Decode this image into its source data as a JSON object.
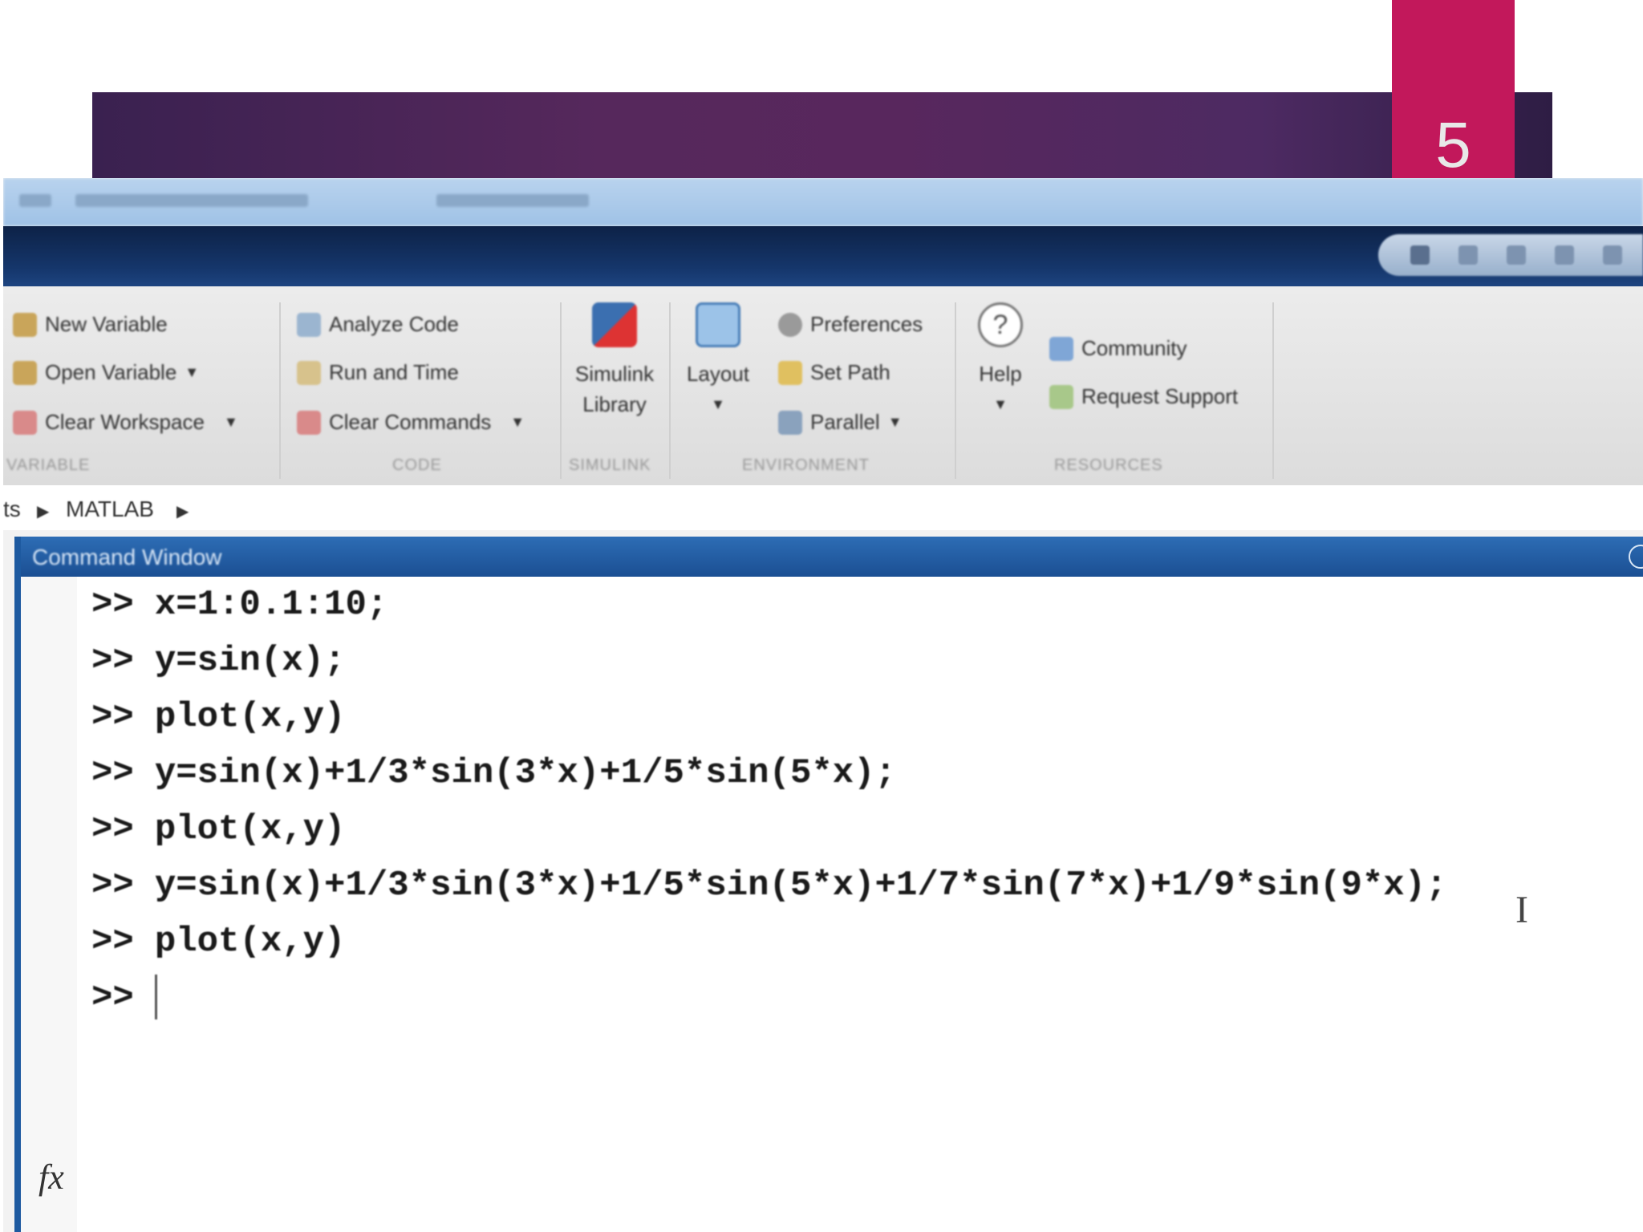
{
  "slide": {
    "number": "5"
  },
  "toolstrip": {
    "variable_group": {
      "items": [
        {
          "label": "New Variable",
          "icon": "new-variable-icon",
          "dropdown": false
        },
        {
          "label": "Open Variable",
          "icon": "open-variable-icon",
          "dropdown": true
        },
        {
          "label": "Clear Workspace",
          "icon": "clear-workspace-icon",
          "dropdown": true
        }
      ],
      "label": "VARIABLE"
    },
    "code_group": {
      "items": [
        {
          "label": "Analyze Code",
          "icon": "analyze-code-icon",
          "dropdown": false
        },
        {
          "label": "Run and Time",
          "icon": "run-and-time-icon",
          "dropdown": false
        },
        {
          "label": "Clear Commands",
          "icon": "clear-commands-icon",
          "dropdown": true
        }
      ],
      "label": "CODE"
    },
    "simulink_group": {
      "button_line1": "Simulink",
      "button_line2": "Library",
      "label": "SIMULINK"
    },
    "environment_group": {
      "layout_label": "Layout",
      "items": [
        {
          "label": "Preferences",
          "icon": "preferences-icon",
          "dropdown": false
        },
        {
          "label": "Set Path",
          "icon": "set-path-icon",
          "dropdown": false
        },
        {
          "label": "Parallel",
          "icon": "parallel-icon",
          "dropdown": true
        }
      ],
      "label": "ENVIRONMENT"
    },
    "resources_group": {
      "help_label": "Help",
      "items": [
        {
          "label": "Community",
          "icon": "community-icon"
        },
        {
          "label": "Request Support",
          "icon": "request-support-icon"
        }
      ],
      "label": "RESOURCES"
    }
  },
  "pathbar": {
    "crumb_prefix": "ts",
    "crumb_current": "MATLAB"
  },
  "command_window": {
    "title": "Command Window",
    "prompt": ">>",
    "lines": [
      "x=1:0.1:10;",
      "y=sin(x);",
      "plot(x,y)",
      "y=sin(x)+1/3*sin(3*x)+1/5*sin(5*x);",
      "plot(x,y)",
      "y=sin(x)+1/3*sin(3*x)+1/5*sin(5*x)+1/7*sin(7*x)+1/9*sin(9*x);",
      "plot(x,y)"
    ],
    "fx_label": "fx",
    "colors": {
      "title_bar": "#1e5aa0",
      "text": "#1a1a1a"
    }
  },
  "colors": {
    "slide_banner": "#56285c",
    "slide_tab": "#c2185b",
    "tabstrip": "#15366b",
    "toolstrip": "#e4e4e4"
  }
}
